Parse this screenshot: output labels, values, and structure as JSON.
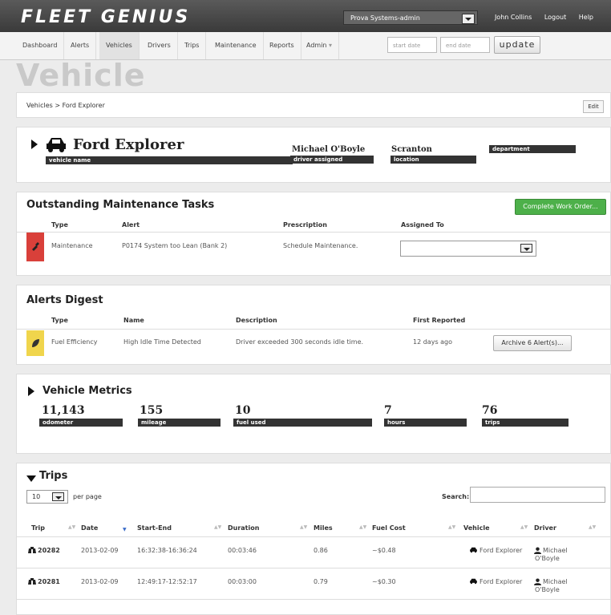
{
  "app": {
    "logo": "FLEET GENIUS",
    "account": "Prova Systems-admin",
    "user": "John Collins",
    "logout": "Logout",
    "help": "Help"
  },
  "nav": {
    "tabs": [
      "Dashboard",
      "Alerts",
      "Vehicles",
      "Drivers",
      "Trips",
      "Maintenance",
      "Reports",
      "Admin"
    ],
    "admin_caret": "▾",
    "start_placeholder": "start date",
    "end_placeholder": "end date",
    "update": "update"
  },
  "page": {
    "title": "Vehicle",
    "breadcrumb": "Vehicles > Ford Explorer",
    "edit": "Edit"
  },
  "vehicle": {
    "name": "Ford Explorer",
    "name_label": "vehicle name",
    "driver": "Michael O'Boyle",
    "driver_label": "driver assigned",
    "location": "Scranton",
    "location_label": "location",
    "department_label": "department"
  },
  "maintenance": {
    "title": "Outstanding Maintenance Tasks",
    "complete_btn": "Complete Work Order...",
    "headers": [
      "Type",
      "Alert",
      "Prescription",
      "Assigned To"
    ],
    "row": {
      "type": "Maintenance",
      "alert": "P0174 System too Lean (Bank 2)",
      "prescription": "Schedule Maintenance."
    },
    "status_color": "#d9403a"
  },
  "alerts": {
    "title": "Alerts Digest",
    "headers": [
      "Type",
      "Name",
      "Description",
      "First Reported"
    ],
    "row": {
      "type": "Fuel Efficiency",
      "name": "High Idle Time Detected",
      "description": "Driver exceeded 300 seconds idle time.",
      "reported": "12 days ago"
    },
    "archive_btn": "Archive 6 Alert(s)...",
    "status_color": "#f0d54c"
  },
  "metrics": {
    "title": "Vehicle Metrics",
    "items": [
      {
        "value": "11,143",
        "label": "odometer"
      },
      {
        "value": "155",
        "label": "mileage"
      },
      {
        "value": "10",
        "label": "fuel used"
      },
      {
        "value": "7",
        "label": "hours"
      },
      {
        "value": "76",
        "label": "trips"
      }
    ]
  },
  "trips": {
    "title": "Trips",
    "per_page_value": "10",
    "per_page_label": "per page",
    "search_label": "Search:",
    "headers": [
      "Trip",
      "Date",
      "Start-End",
      "Duration",
      "Miles",
      "Fuel Cost",
      "Vehicle",
      "Driver"
    ],
    "rows": [
      {
        "trip": "20282",
        "date": "2013-02-09",
        "start_end": "16:32:38-16:36:24",
        "duration": "00:03:46",
        "miles": "0.86",
        "fuel": "~$0.48",
        "vehicle": "Ford Explorer",
        "driver_first": "Michael",
        "driver_last": "O'Boyle"
      },
      {
        "trip": "20281",
        "date": "2013-02-09",
        "start_end": "12:49:17-12:52:17",
        "duration": "00:03:00",
        "miles": "0.79",
        "fuel": "~$0.30",
        "vehicle": "Ford Explorer",
        "driver_first": "Michael",
        "driver_last": "O'Boyle"
      }
    ]
  }
}
